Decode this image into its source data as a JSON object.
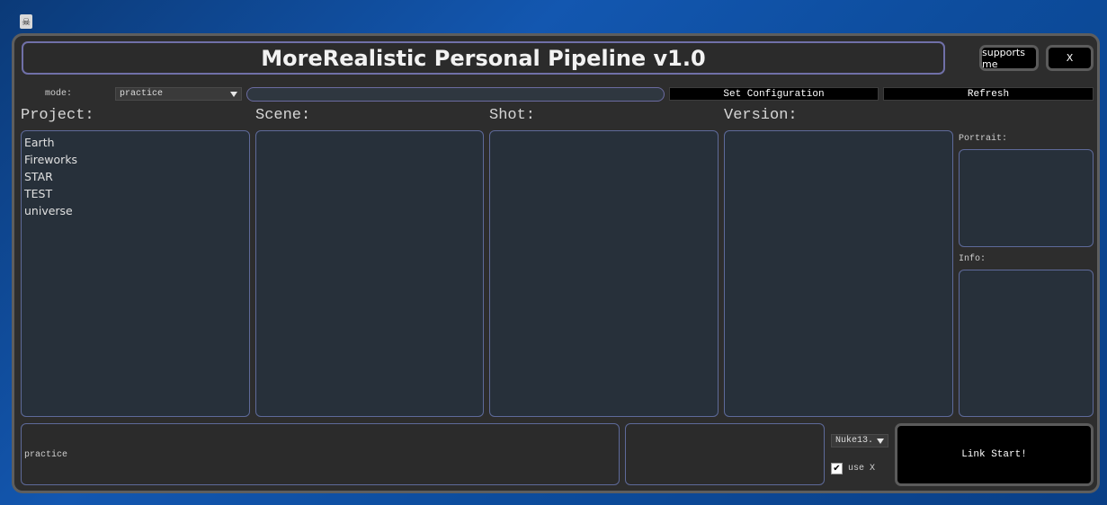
{
  "desktop": {
    "icon": "ghost-app-icon",
    "icon_glyph": "☠"
  },
  "window": {
    "title": "MoreRealistic Personal Pipeline v1.0",
    "supports_label": "supports me",
    "close_label": "X"
  },
  "toolbar": {
    "mode_label": "mode:",
    "mode_value": "practice",
    "path_value": "",
    "set_config_label": "Set Configuration",
    "refresh_label": "Refresh"
  },
  "columns": {
    "project": {
      "header": "Project:",
      "items": [
        "Earth",
        "Fireworks",
        "STAR",
        "TEST",
        "universe"
      ]
    },
    "scene": {
      "header": "Scene:",
      "items": []
    },
    "shot": {
      "header": "Shot:",
      "items": []
    },
    "version": {
      "header": "Version:",
      "items": []
    }
  },
  "side": {
    "portrait_label": "Portrait:",
    "info_label": "Info:"
  },
  "bottom": {
    "status_text": "practice",
    "software_value": "Nuke13.",
    "use_x_label": "use X",
    "use_x_checked": true,
    "link_start_label": "Link Start!"
  }
}
